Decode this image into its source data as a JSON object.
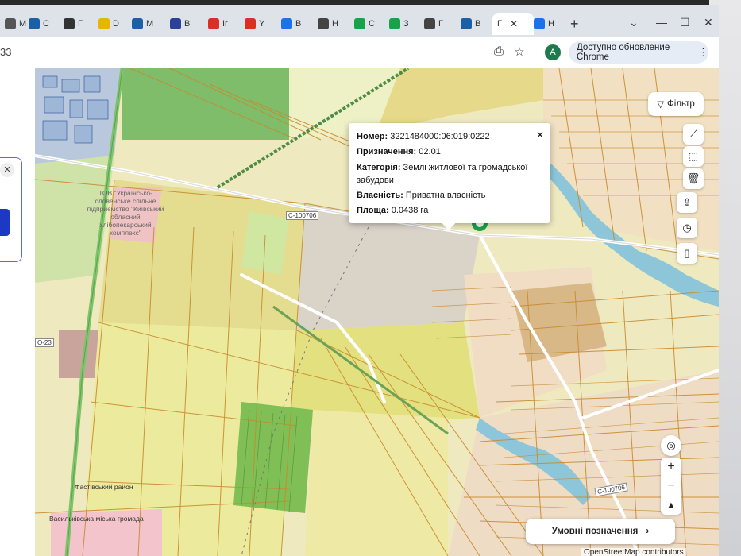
{
  "browser": {
    "tabs": [
      {
        "label": "М",
        "icon": "generic-tab-icon",
        "color": "#555"
      },
      {
        "label": "С",
        "icon": "cotir-icon",
        "color": "#1b5fa7"
      },
      {
        "label": "Г",
        "icon": "g-icon",
        "color": "#333"
      },
      {
        "label": "D",
        "icon": "yellow-circle-icon",
        "color": "#e3b800"
      },
      {
        "label": "М",
        "icon": "cotir-icon",
        "color": "#1b5fa7"
      },
      {
        "label": "В",
        "icon": "b-icon",
        "color": "#2c3f99"
      },
      {
        "label": "Ir",
        "icon": "gmail-icon",
        "color": "#d93025"
      },
      {
        "label": "Y",
        "icon": "gmail-icon",
        "color": "#d93025"
      },
      {
        "label": "В",
        "icon": "blue-square-icon",
        "color": "#1a73e8"
      },
      {
        "label": "Н",
        "icon": "chrome-icon",
        "color": "#444"
      },
      {
        "label": "С",
        "icon": "green-circle-icon",
        "color": "#16a34a"
      },
      {
        "label": "З",
        "icon": "green-circle-icon",
        "color": "#16a34a"
      },
      {
        "label": "Г",
        "icon": "map-icon",
        "color": "#444"
      },
      {
        "label": "В",
        "icon": "cotir-icon",
        "color": "#1b5fa7"
      },
      {
        "label": "Г",
        "icon": "active-tab",
        "color": "#333"
      },
      {
        "label": "Н",
        "icon": "gear-icon",
        "color": "#1a73e8"
      }
    ],
    "url_fragment": "33",
    "profile_initial": "A",
    "update_text": "Доступно обновление Chrome"
  },
  "map": {
    "filter_label": "Фільтр",
    "popup": {
      "number_label": "Номер:",
      "number_value": "3221484000:06:019:0222",
      "purpose_label": "Призначення:",
      "purpose_value": "02.01",
      "category_label": "Категорія:",
      "category_value": "Землі житлової та громадської забудови",
      "ownership_label": "Власність:",
      "ownership_value": "Приватна власність",
      "area_label": "Площа:",
      "area_value": "0.0438 га"
    },
    "labels": {
      "road_1": "С-100706",
      "road_2": "С-100706",
      "road_left": "О-23",
      "company": "ТОВ \"Українсько-словенське спільне підприємство \"Київський обласний хлібопекарський комплекс\"",
      "district": "Фастівський район",
      "community": "Васильківська міська громада"
    },
    "legend_button": "Умовні позначення",
    "attribution": "OpenStreetMap contributors"
  }
}
